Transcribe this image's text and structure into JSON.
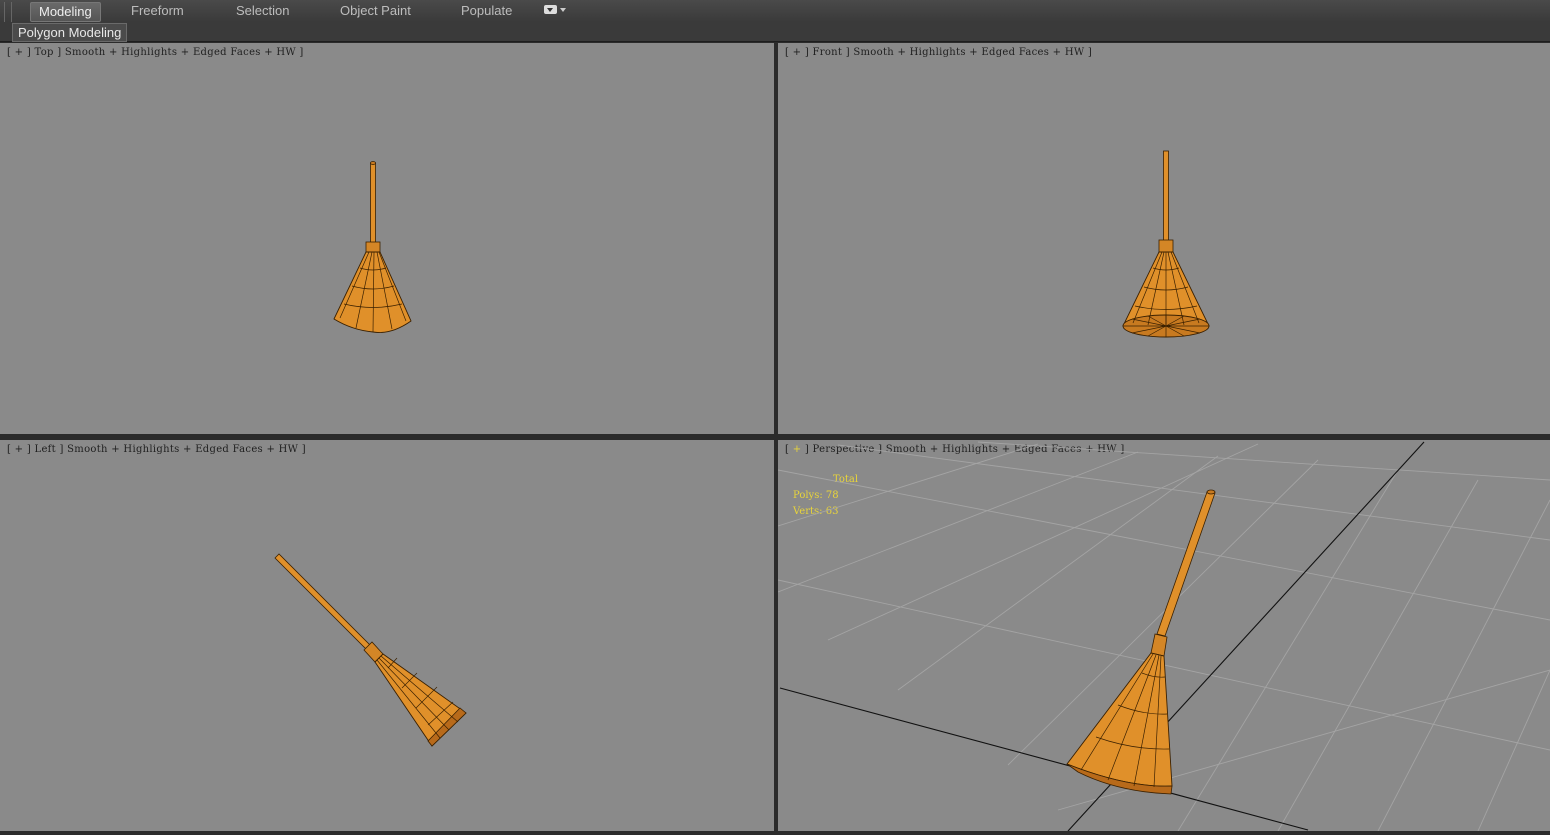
{
  "ribbon": {
    "tabs": [
      {
        "label": "Modeling",
        "active": true
      },
      {
        "label": "Freeform",
        "active": false
      },
      {
        "label": "Selection",
        "active": false
      },
      {
        "label": "Object Paint",
        "active": false
      },
      {
        "label": "Populate",
        "active": false
      }
    ],
    "panel_label": "Polygon Modeling"
  },
  "viewports": {
    "top": {
      "label": "[ + ] Top ] Smooth + Highlights + Edged Faces + HW ]"
    },
    "front": {
      "label": "[ + ] Front ] Smooth + Highlights + Edged Faces + HW ]"
    },
    "left": {
      "label": "[ + ] Left ] Smooth + Highlights + Edged Faces + HW ]"
    },
    "perspective": {
      "label_open": "[ ",
      "label_plus": "+",
      "label_rest": " ] Perspective ] Smooth + Highlights + Edged Faces + HW ]",
      "stats": {
        "title": "Total",
        "polys": "Polys: 78",
        "verts": "Verts: 63"
      }
    }
  },
  "colors": {
    "viewport_bg": "#8a8a8a",
    "broom_fill": "#e0902a",
    "broom_dark": "#a8601a",
    "stats_text": "#e8d43a"
  }
}
